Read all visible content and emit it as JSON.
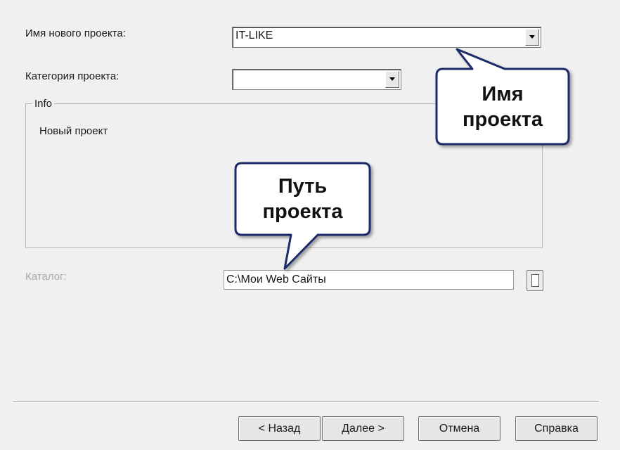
{
  "form": {
    "project_name_label": "Имя нового проекта:",
    "project_name_value": "IT-LIKE",
    "category_label": "Категория проекта:",
    "category_value": "",
    "info_group_title": "Info",
    "info_text": "Новый проект",
    "catalog_label": "Каталог:",
    "catalog_value": "C:\\Мои Web Сайты"
  },
  "buttons": {
    "back": "< Назад",
    "next": "Далее >",
    "cancel": "Отмена",
    "help": "Справка"
  },
  "callouts": {
    "name_line1": "Имя",
    "name_line2": "проекта",
    "path_line1": "Путь",
    "path_line2": "проекта"
  },
  "colors": {
    "callout_border": "#1f2a6b",
    "callout_fill": "#ffffff",
    "dialog_bg": "#f0f0f0"
  },
  "icons": {
    "dropdown": "chevron-down-icon",
    "browse": "folder-browse-icon"
  }
}
